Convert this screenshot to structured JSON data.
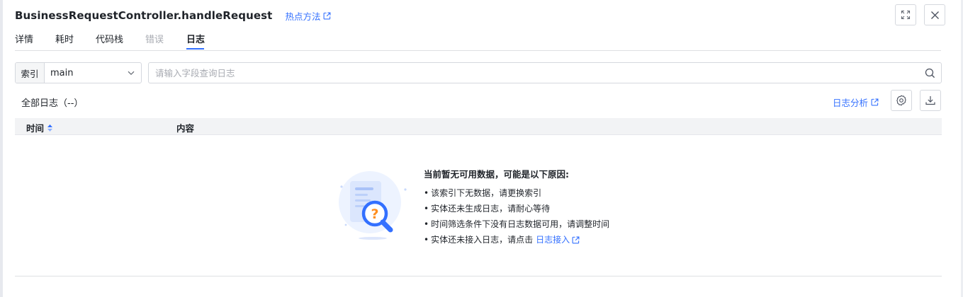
{
  "header": {
    "title": "BusinessRequestController.handleRequest",
    "hot_method_link": "热点方法"
  },
  "tabs": [
    {
      "label": "详情",
      "state": "normal"
    },
    {
      "label": "耗时",
      "state": "normal"
    },
    {
      "label": "代码栈",
      "state": "normal"
    },
    {
      "label": "错误",
      "state": "disabled"
    },
    {
      "label": "日志",
      "state": "active"
    }
  ],
  "filter": {
    "index_label": "索引",
    "index_value": "main",
    "search_placeholder": "请输入字段查询日志"
  },
  "toolbar": {
    "log_count": "全部日志（--）",
    "analysis_link": "日志分析"
  },
  "table": {
    "columns": [
      "时间",
      "内容"
    ]
  },
  "empty_state": {
    "title": "当前暂无可用数据，可能是以下原因:",
    "reasons": [
      "该索引下无数据，请更换索引",
      "实体还未生成日志，请耐心等待",
      "时间筛选条件下没有日志数据可用，请调整时间",
      "实体还未接入日志，请点击"
    ],
    "access_link": "日志接入"
  },
  "icons": {
    "expand": "expand-icon",
    "close": "close-icon",
    "external": "external-link-icon",
    "search": "search-icon",
    "settings": "gear-icon",
    "download": "download-icon",
    "sort": "sort-icon",
    "chevron": "chevron-down-icon"
  },
  "colors": {
    "accent": "#3370ff",
    "text": "#1f2329",
    "muted": "#a8abb2",
    "border": "#d5d8de"
  }
}
